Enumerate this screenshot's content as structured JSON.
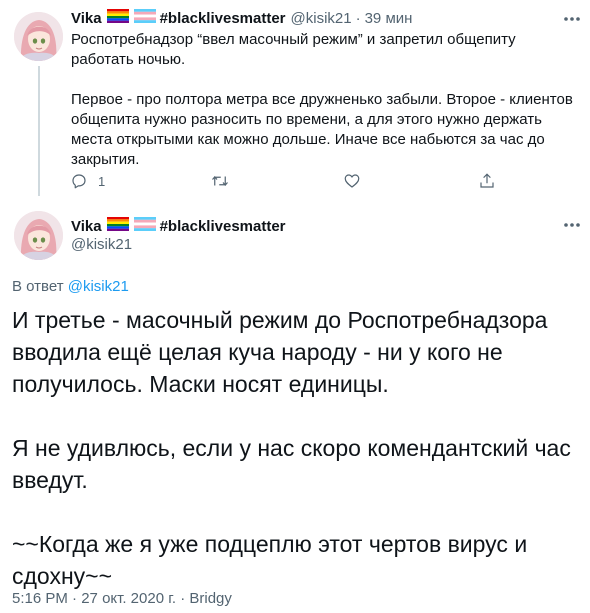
{
  "colors": {
    "text": "#0f1419",
    "muted": "#536471",
    "link": "#1d9bf0",
    "thread_line": "#cfd9de"
  },
  "tweet_parent": {
    "display_name": "Vika",
    "hashtag": "#blacklivesmatter",
    "handle": "@kisik21",
    "separator": "·",
    "time": "39 мин",
    "paragraphs": [
      "Роспотребнадзор “ввел масочный режим” и запретил общепиту работать ночью.",
      "Первое - про полтора метра все дружненько забыли. Второе - клиентов общепита нужно разносить по времени, а для этого нужно держать места открытыми как можно дольше. Иначе все набьются за час до закрытия."
    ],
    "actions": {
      "reply_count": "1",
      "icons": [
        "reply-icon",
        "retweet-icon",
        "like-icon",
        "share-icon"
      ]
    }
  },
  "tweet_main": {
    "display_name": "Vika",
    "hashtag": "#blacklivesmatter",
    "handle": "@kisik21",
    "reply_prefix": "В ответ",
    "reply_mention": "@kisik21",
    "paragraphs": [
      "И третье - масочный режим до Роспотребнадзора вводила ещё целая куча народу - ни у кого не получилось. Маски носят единицы.",
      "Я не удивлюсь, если у нас скоро комендантский час введут.",
      "~~Когда же я уже подцеплю этот чертов вирус и сдохну~~"
    ],
    "time": "5:16 PM",
    "date": "27 окт. 2020 г.",
    "separator": "·",
    "source": "Bridgy"
  },
  "icons": {
    "more": "more-icon",
    "flags": [
      "rainbow-flag-icon",
      "transgender-flag-icon"
    ]
  }
}
